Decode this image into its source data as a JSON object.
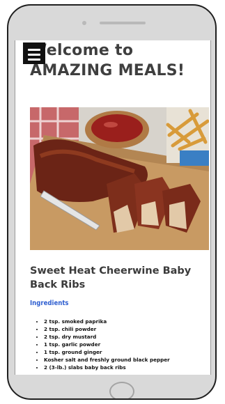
{
  "header": {
    "welcome_line1": "Welcome to",
    "welcome_line2": "AMAZING MEALS!"
  },
  "menu": {
    "icon": "hamburger-menu-icon"
  },
  "hero_image": {
    "subject": "sliced glazed baby back ribs with dipping sauce and fries"
  },
  "recipe": {
    "title": "Sweet Heat Cheerwine Baby Back Ribs",
    "ingredients_heading": "Ingredients",
    "ingredients": [
      "2 tsp. smoked paprika",
      "2 tsp. chili powder",
      "2 tsp. dry mustard",
      "1 tsp. garlic powder",
      "1 tsp. ground ginger",
      "Kosher salt and freshly ground black pepper",
      "2 (3-lb.) slabs baby back ribs"
    ]
  },
  "colors": {
    "accent": "#2f5fd0",
    "heading": "#3f3f3f",
    "phone_frame": "#d9d9d9"
  }
}
